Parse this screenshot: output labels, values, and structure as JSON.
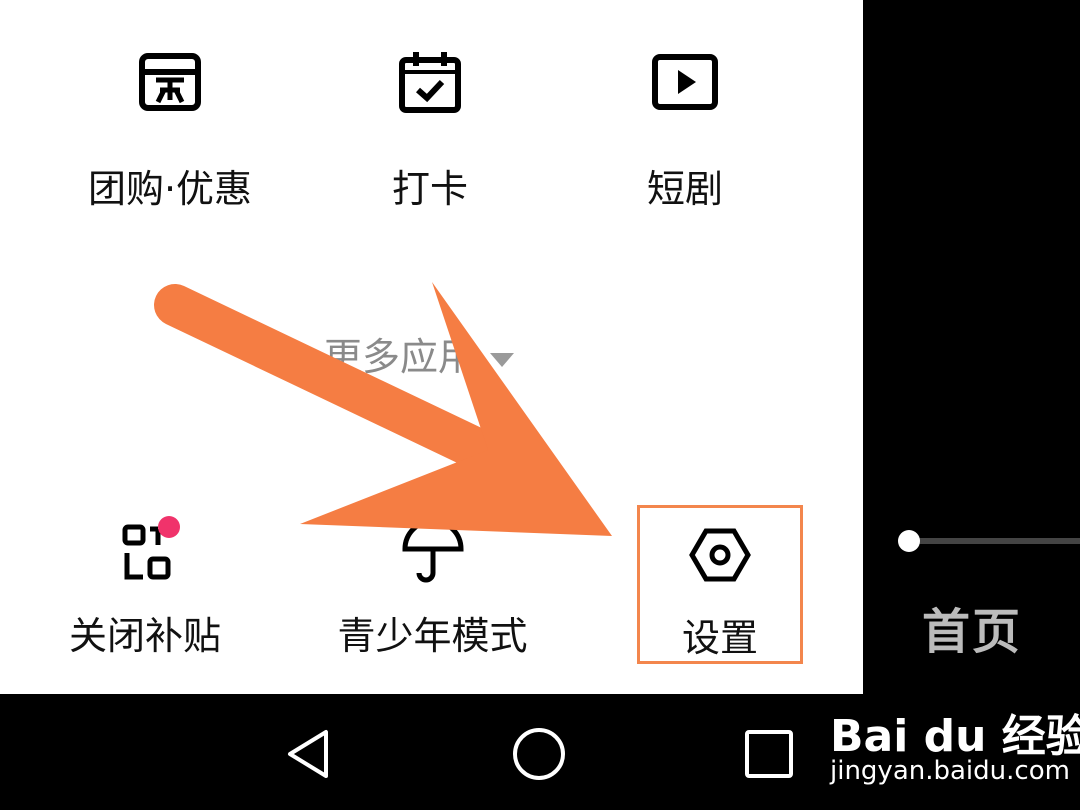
{
  "apps_row1": [
    {
      "label": "团购·优惠",
      "icon": "shop-icon"
    },
    {
      "label": "打卡",
      "icon": "calendar-check-icon"
    },
    {
      "label": "短剧",
      "icon": "play-icon"
    }
  ],
  "more_apps": {
    "label": "更多应用",
    "icon": "caret-down-icon"
  },
  "apps_row2": [
    {
      "label": "关闭补贴",
      "icon": "subsidy-icon"
    },
    {
      "label": "青少年模式",
      "icon": "umbrella-icon"
    },
    {
      "label": "设置",
      "icon": "gear-icon"
    }
  ],
  "side": {
    "home_label": "首页"
  },
  "watermark": {
    "brand": "Bai du 经验",
    "url": "jingyan.baidu.com"
  },
  "colors": {
    "arrow": "#f57d43",
    "highlight_box": "#f3864d",
    "badge": "#f0336b"
  }
}
